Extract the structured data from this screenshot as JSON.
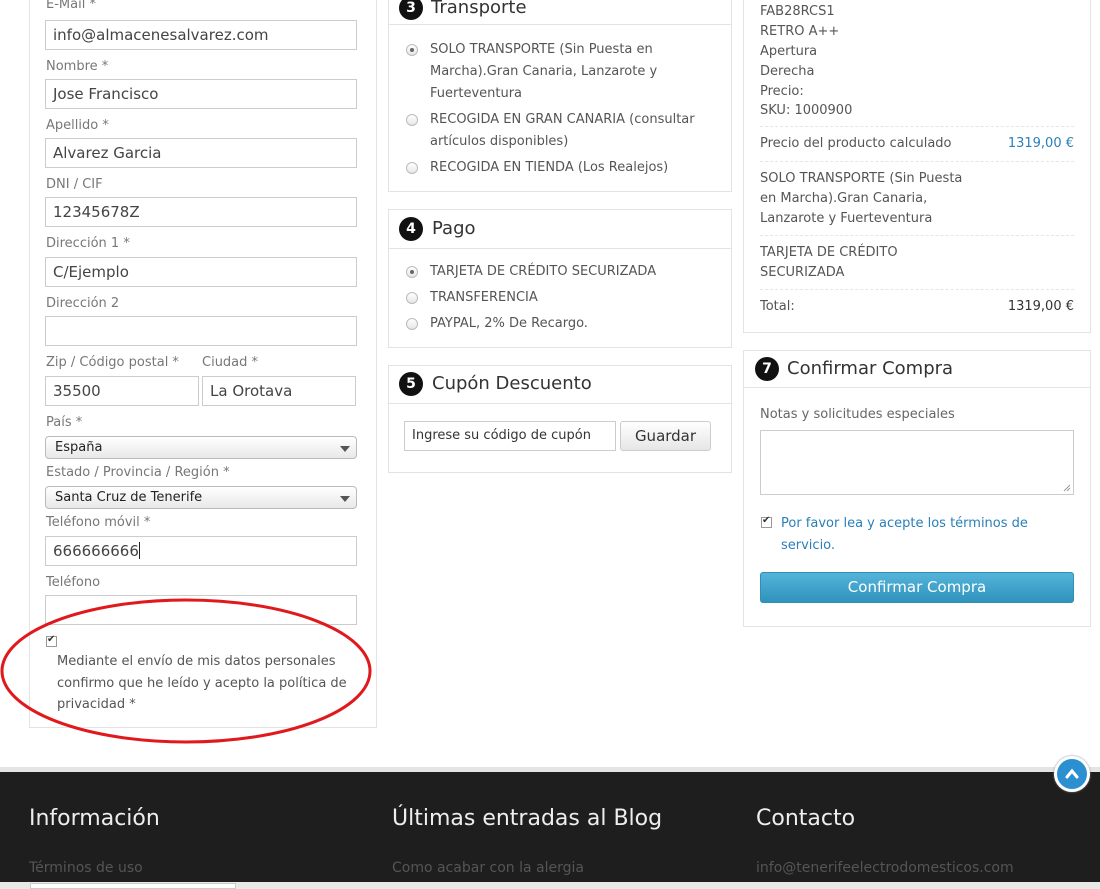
{
  "form": {
    "email_label": "E-Mail *",
    "email_value": "info@almacenesalvarez.com",
    "nombre_label": "Nombre *",
    "nombre_value": "Jose Francisco",
    "apellido_label": "Apellido *",
    "apellido_value": "Alvarez Garcia",
    "dni_label": "DNI / CIF",
    "dni_value": "12345678Z",
    "dir1_label": "Dirección 1 *",
    "dir1_value": "C/Ejemplo",
    "dir2_label": "Dirección 2",
    "dir2_value": "",
    "zip_label": "Zip / Código postal *",
    "zip_value": "35500",
    "ciudad_label": "Ciudad *",
    "ciudad_value": "La Orotava",
    "pais_label": "País *",
    "pais_value": "España",
    "estado_label": "Estado / Provincia / Región *",
    "estado_value": "Santa Cruz de Tenerife",
    "movil_label": "Teléfono móvil *",
    "movil_value": "666666666",
    "telefono_label": "Teléfono",
    "telefono_value": "",
    "privacy_text": "Mediante el envío de mis datos personales confirmo que he leído y acepto la política de privacidad *"
  },
  "transporte": {
    "number": "3",
    "title": "Transporte",
    "options": [
      {
        "label": "SOLO TRANSPORTE (Sin Puesta en Marcha).Gran Canaria, Lanzarote y Fuerteventura",
        "selected": true
      },
      {
        "label": "RECOGIDA EN GRAN CANARIA (consultar artículos disponibles)",
        "selected": false
      },
      {
        "label": "RECOGIDA EN TIENDA (Los Realejos)",
        "selected": false
      }
    ]
  },
  "pago": {
    "number": "4",
    "title": "Pago",
    "options": [
      {
        "label": "TARJETA DE CRÉDITO SECURIZADA",
        "selected": true
      },
      {
        "label": "TRANSFERENCIA",
        "selected": false
      },
      {
        "label": "PAYPAL, 2% De Recargo.",
        "selected": false
      }
    ]
  },
  "cupon": {
    "number": "5",
    "title": "Cupón Descuento",
    "placeholder": "Ingrese su código de cupón",
    "button": "Guardar"
  },
  "summary": {
    "product_lines": [
      "FAB28RCS1",
      "RETRO A++",
      "Apertura",
      "Derecha",
      "Precio:",
      "SKU: 1000900"
    ],
    "calc_label": "Precio del producto calculado",
    "calc_value": "1319,00 €",
    "transport_text": "SOLO TRANSPORTE (Sin Puesta en Marcha).Gran Canaria, Lanzarote y Fuerteventura",
    "payment_text": "TARJETA DE CRÉDITO SECURIZADA",
    "total_label": "Total:",
    "total_value": "1319,00 €"
  },
  "confirm": {
    "number": "7",
    "title": "Confirmar Compra",
    "notes_label": "Notas y solicitudes especiales",
    "terms_text": "Por favor lea y acepte los términos de servicio.",
    "button": "Confirmar Compra"
  },
  "footer": {
    "col1_title": "Información",
    "col1_link": "Términos de uso",
    "col2_title": "Últimas entradas al Blog",
    "col2_link": "Como acabar con la alergia",
    "col3_title": "Contacto",
    "col3_link": "info@tenerifeelectrodomesticos.com"
  },
  "colors": {
    "link": "#2a7fb8",
    "button": "#3ea3cc",
    "footer": "#1e1e1e"
  }
}
